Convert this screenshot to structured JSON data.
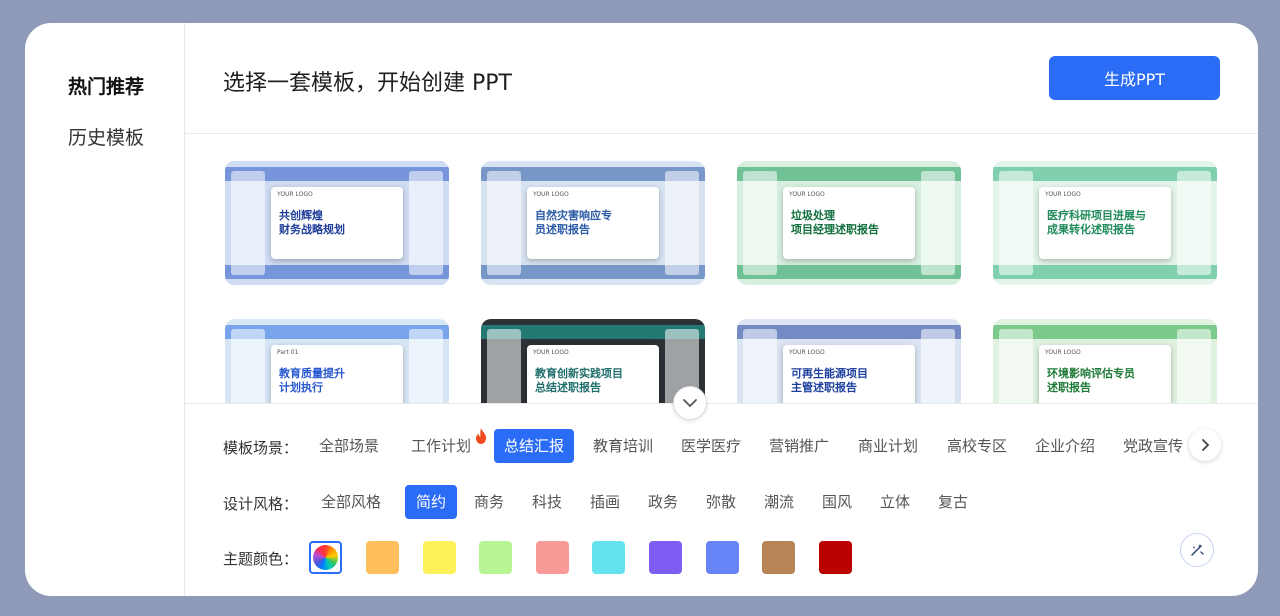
{
  "sidebar": {
    "items": [
      {
        "label": "热门推荐",
        "active": true
      },
      {
        "label": "历史模板",
        "active": false
      }
    ]
  },
  "header": {
    "title": "选择一套模板，开始创建 PPT",
    "generate_label": "生成PPT"
  },
  "templates": [
    {
      "title": "共创辉煌\n财务战略规划",
      "head": "YOUR LOGO",
      "accent": "#2e5bc7",
      "bg": "#cfdcf3",
      "title_color": "#1f3f9a",
      "selected": true
    },
    {
      "title": "自然灾害响应专\n员述职报告",
      "head": "YOUR LOGO",
      "accent": "#2a5aa8",
      "bg": "#d8e3f2",
      "title_color": "#2a5aa8",
      "selected": false
    },
    {
      "title": "垃圾处理\n项目经理述职报告",
      "head": "YOUR LOGO",
      "accent": "#1e9a5a",
      "bg": "#d8efe0",
      "title_color": "#0f6e3c",
      "selected": false
    },
    {
      "title": "医疗科研项目进展与\n成果转化述职报告",
      "head": "YOUR LOGO",
      "accent": "#2fb37a",
      "bg": "#e3f4ea",
      "title_color": "#1f8a5a",
      "selected": false
    },
    {
      "title": "教育质量提升\n计划执行",
      "head": "Part 01",
      "accent": "#2a6ee0",
      "bg": "#d6e6f5",
      "title_color": "#2a5ad0",
      "selected": false
    },
    {
      "title": "教育创新实践项目\n总结述职报告",
      "head": "YOUR LOGO",
      "accent": "#1fb5a8",
      "bg": "#2c3136",
      "title_color": "#ffffff",
      "selected": false
    },
    {
      "title": "可再生能源项目\n主管述职报告",
      "head": "YOUR LOGO",
      "accent": "#1d3f9e",
      "bg": "#dbe4f3",
      "title_color": "#1d3f9e",
      "selected": false
    },
    {
      "title": "环境影响评估专员\n述职报告",
      "head": "YOUR LOGO",
      "accent": "#28a745",
      "bg": "#dff1df",
      "title_color": "#1e7a36",
      "selected": false
    }
  ],
  "filters": {
    "scene_label": "模板场景：",
    "scenes": [
      "全部场景",
      "工作计划",
      "总结汇报",
      "教育培训",
      "医学医疗",
      "营销推广",
      "商业计划",
      "高校专区",
      "企业介绍",
      "党政宣传"
    ],
    "active_scene": 2,
    "hot_scene": 1,
    "style_label": "设计风格：",
    "styles": [
      "全部风格",
      "简约",
      "商务",
      "科技",
      "插画",
      "政务",
      "弥散",
      "潮流",
      "国风",
      "立体",
      "复古"
    ],
    "active_style": 1,
    "color_label": "主题颜色：",
    "colors": [
      "#ffbf5c",
      "#fef15a",
      "#b8f595",
      "#f99a98",
      "#64e3ee",
      "#7e5df3",
      "#6684f6",
      "#b98455",
      "#bb0000"
    ]
  }
}
